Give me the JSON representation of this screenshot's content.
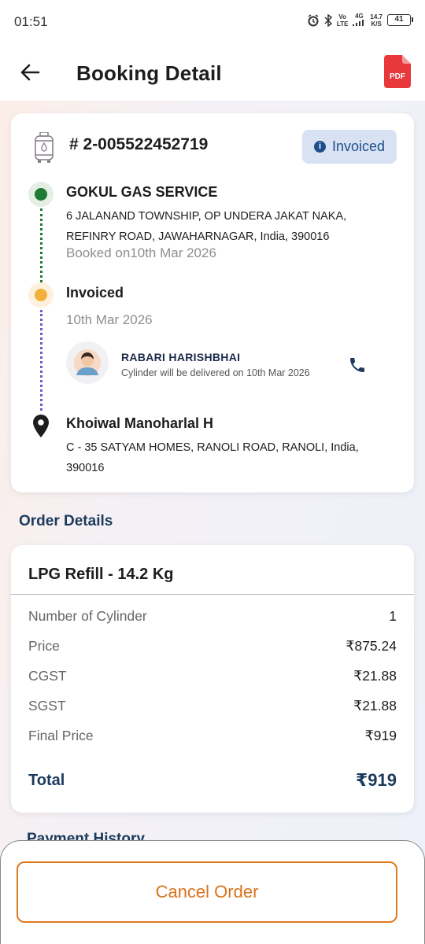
{
  "status_bar": {
    "time": "01:51",
    "network_top": "Vo",
    "network_bottom": "LTE",
    "signal_label": "4G",
    "speed_top": "14.7",
    "speed_bottom": "K/S",
    "battery": "41"
  },
  "header": {
    "title": "Booking Detail",
    "pdf_label": "PDF"
  },
  "booking": {
    "id": "# 2-005522452719",
    "status": "Invoiced",
    "distributor": {
      "name": "GOKUL GAS SERVICE",
      "address_line1": "6 JALANAND TOWNSHIP, OP UNDERA JAKAT NAKA,",
      "address_line2": "REFINRY  ROAD, JAWAHARNAGAR, India, 390016",
      "booked_on": "Booked on10th Mar 2026"
    },
    "invoice_step": {
      "title": "Invoiced",
      "date": "10th Mar 2026"
    },
    "delivery_agent": {
      "name": "RABARI HARISHBHAI",
      "note": "Cylinder will be delivered on 10th Mar 2026"
    },
    "customer": {
      "name": "Khoiwal Manoharlal H",
      "address_line1": "C - 35 SATYAM HOMES, RANOLI ROAD, RANOLI, India,",
      "address_line2": "390016"
    }
  },
  "order_details": {
    "section_title": "Order Details",
    "product": "LPG Refill - 14.2 Kg",
    "rows": [
      {
        "label": "Number of Cylinder",
        "value": "1"
      },
      {
        "label": "Price",
        "value": "₹875.24"
      },
      {
        "label": "CGST",
        "value": "₹21.88"
      },
      {
        "label": "SGST",
        "value": "₹21.88"
      },
      {
        "label": "Final Price",
        "value": "₹919"
      }
    ],
    "total_label": "Total",
    "total_value": "₹919"
  },
  "payment_history": {
    "section_title": "Payment History"
  },
  "actions": {
    "cancel_label": "Cancel Order"
  },
  "colors": {
    "accent_blue": "#1b3a5c",
    "chip_bg": "#d8e2f3",
    "green_dot": "#1f7a34",
    "yellow_dot": "#f2b03a",
    "cancel_orange": "#e07a1f",
    "pdf_red": "#e8383b"
  }
}
